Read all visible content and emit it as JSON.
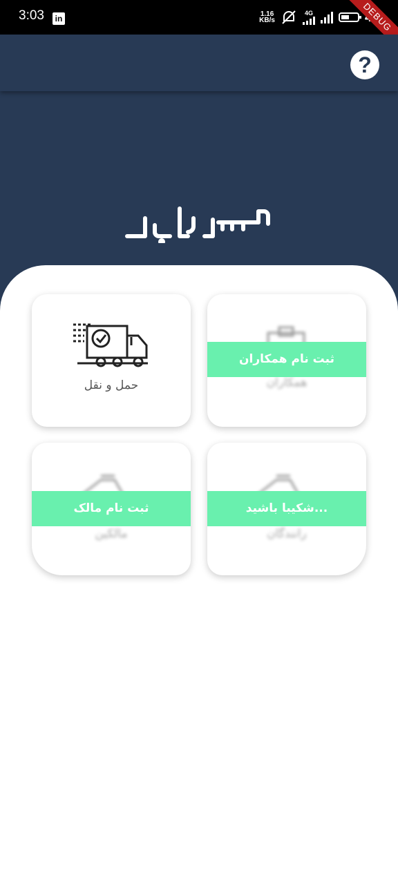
{
  "status_bar": {
    "time": "3:03",
    "linkedin_glyph": "in",
    "net_speed_value": "1.16",
    "net_speed_unit": "KB/s",
    "network_type": "4G",
    "battery_level": "46",
    "debug_ribbon": "DEBUG"
  },
  "app_bar": {
    "help_label": "?"
  },
  "brand": {
    "logo_text": "آسیا ز بار"
  },
  "cards": [
    {
      "title": "حمل و نقل",
      "icon": "delivery-truck-check-icon"
    },
    {
      "title": "همکاران",
      "banner": "ثبت نام همکاران",
      "icon": "clipboard-icon"
    },
    {
      "title": "مالکین",
      "banner": "ثبت نام مالک",
      "icon": "truck-icon"
    },
    {
      "title": "رانندگان",
      "banner": "شکیبا باشید...",
      "icon": "truck-icon"
    }
  ],
  "colors": {
    "primary": "#283a55",
    "banner": "#69f0ae",
    "debug": "#b71c1c"
  }
}
